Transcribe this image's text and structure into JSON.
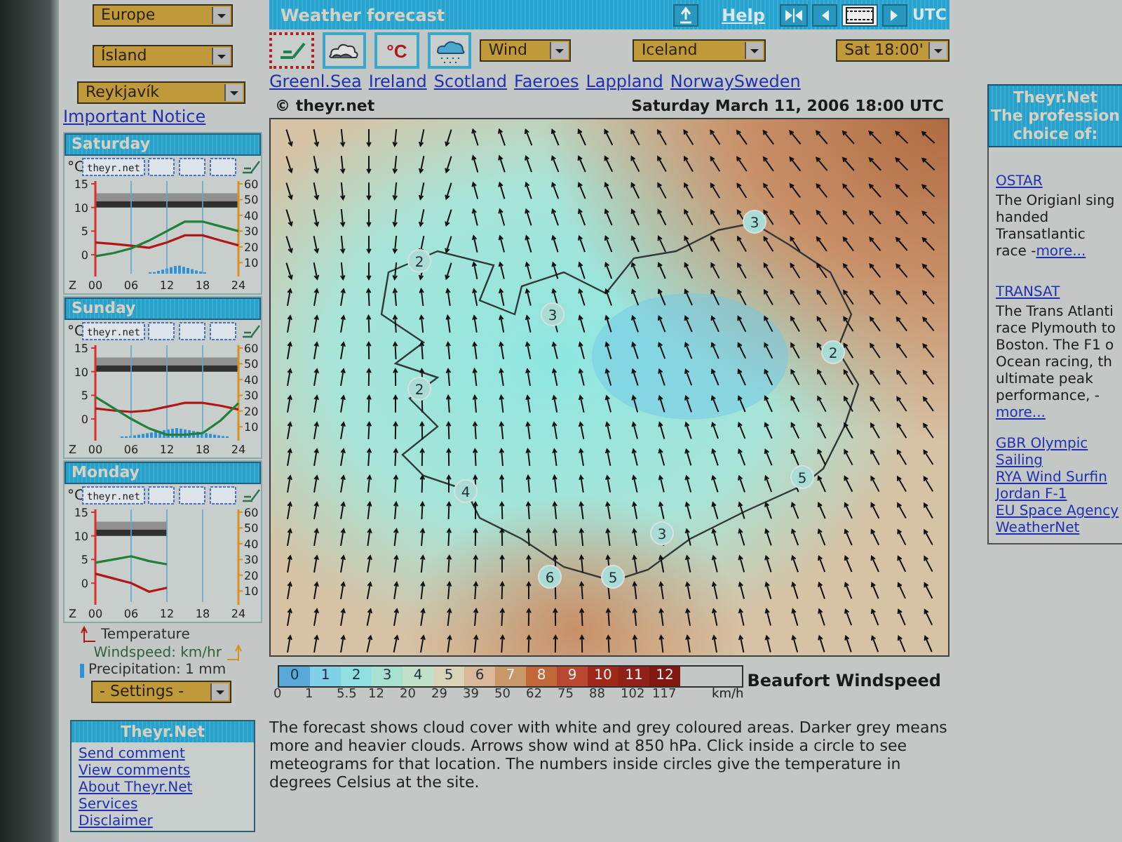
{
  "nav": {
    "continent": "Europe",
    "country": "Ísland",
    "city": "Reykjavík",
    "notice": "Important Notice"
  },
  "days": [
    {
      "title": "Saturday",
      "unit": "°C",
      "logo": "theyr.net",
      "zone": "Z",
      "chart_data": {
        "type": "line",
        "grid": true,
        "x": [
          0,
          3,
          6,
          9,
          12,
          15,
          18,
          21,
          24
        ],
        "xlim": [
          0,
          24
        ],
        "xticks": [
          {
            "value": 0,
            "label": "00"
          },
          {
            "value": 6,
            "label": "06"
          },
          {
            "value": 12,
            "label": "12"
          },
          {
            "value": 18,
            "label": "18"
          },
          {
            "value": 24,
            "label": "24"
          }
        ],
        "ylim": [
          -4,
          15
        ],
        "yticks": [
          0,
          5,
          10,
          15
        ],
        "y2lim": [
          3,
          60
        ],
        "y2ticks": [
          10,
          20,
          30,
          40,
          50,
          60
        ],
        "series": [
          {
            "color": "#b01818",
            "values": [
              2.6,
              2.3,
              1.9,
              1.5,
              2.6,
              4.1,
              4.1,
              3,
              2
            ]
          },
          {
            "axis": "y2",
            "color": "#208038",
            "values": [
              14,
              16,
              19,
              24,
              30,
              36,
              36,
              33,
              30
            ]
          }
        ]
      }
    },
    {
      "title": "Sunday",
      "unit": "°C",
      "logo": "theyr.net",
      "zone": "Z",
      "chart_data": {
        "type": "line",
        "grid": true,
        "x": [
          0,
          3,
          6,
          9,
          12,
          15,
          18,
          21,
          24
        ],
        "xlim": [
          0,
          24
        ],
        "xticks": [
          {
            "value": 0,
            "label": "00"
          },
          {
            "value": 6,
            "label": "06"
          },
          {
            "value": 12,
            "label": "12"
          },
          {
            "value": 18,
            "label": "18"
          },
          {
            "value": 24,
            "label": "24"
          }
        ],
        "ylim": [
          -4,
          15
        ],
        "yticks": [
          0,
          5,
          10,
          15
        ],
        "y2lim": [
          3,
          60
        ],
        "y2ticks": [
          10,
          20,
          30,
          40,
          50,
          60
        ],
        "series": [
          {
            "color": "#b01818",
            "values": [
              2.2,
              1.8,
              1.5,
              1.8,
              2.6,
              3.4,
              3.4,
              2.8,
              2
            ]
          },
          {
            "axis": "y2",
            "color": "#208038",
            "values": [
              29,
              22,
              15,
              9,
              5,
              5,
              6,
              14,
              25
            ]
          }
        ]
      }
    },
    {
      "title": "Monday",
      "unit": "°C",
      "logo": "theyr.net",
      "zone": "Z",
      "chart_data": {
        "type": "line",
        "grid": true,
        "x": [
          0,
          3,
          6,
          9,
          12
        ],
        "xlim": [
          0,
          24
        ],
        "xticks": [
          {
            "value": 0,
            "label": "00"
          },
          {
            "value": 6,
            "label": "06"
          },
          {
            "value": 12,
            "label": "12"
          },
          {
            "value": 18,
            "label": "18"
          },
          {
            "value": 24,
            "label": "24"
          }
        ],
        "ylim": [
          -4,
          15
        ],
        "yticks": [
          0,
          5,
          10,
          15
        ],
        "y2lim": [
          3,
          60
        ],
        "y2ticks": [
          10,
          20,
          30,
          40,
          50,
          60
        ],
        "series": [
          {
            "color": "#b01818",
            "values": [
              2,
              1,
              0,
              -1.8,
              -1
            ]
          },
          {
            "axis": "y2",
            "color": "#208038",
            "values": [
              28,
              30,
              32,
              29,
              27
            ]
          }
        ]
      }
    }
  ],
  "legend": {
    "temperature": "Temperature",
    "windspeed": "Windspeed: km/hr",
    "precipitation": "Precipitation: 1 mm"
  },
  "settings": "- Settings -",
  "links_box": {
    "title": "Theyr.Net",
    "links": [
      "Send comment",
      "View comments",
      "About Theyr.Net",
      "Services",
      "Disclaimer"
    ]
  },
  "top_bar": {
    "title": "Weather forecast",
    "help": "Help",
    "utc": "UTC"
  },
  "layers": [
    {
      "kind": "wind",
      "selected": true
    },
    {
      "kind": "cloud",
      "selected": false
    },
    {
      "kind": "text",
      "label": "°C",
      "selected": false
    },
    {
      "kind": "rain",
      "selected": false
    }
  ],
  "toolbar": {
    "parameter": "Wind",
    "region": "Iceland",
    "time": "Sat 18:00'"
  },
  "regions": [
    "Greenl.Sea",
    "Ireland",
    "Scotland",
    "Faeroes",
    "Lappland",
    "NorwaySweden"
  ],
  "map": {
    "credit": "© theyr.net",
    "timestamp": "Saturday March 11, 2006 18:00 UTC",
    "temperatures": [
      "2",
      "3",
      "3",
      "2",
      "2",
      "4",
      "5",
      "3",
      "6",
      "5"
    ]
  },
  "scale": {
    "levels": [
      {
        "label": "0",
        "color": "#58a8d8"
      },
      {
        "label": "1",
        "color": "#80d0e8"
      },
      {
        "label": "2",
        "color": "#90e0e0"
      },
      {
        "label": "3",
        "color": "#a8e0d0"
      },
      {
        "label": "4",
        "color": "#c0e0c8"
      },
      {
        "label": "5",
        "color": "#d8d4b8"
      },
      {
        "label": "6",
        "color": "#d8b898"
      },
      {
        "label": "7",
        "color": "#c89868"
      },
      {
        "label": "8",
        "color": "#c06838"
      },
      {
        "label": "9",
        "color": "#b84830"
      },
      {
        "label": "10",
        "color": "#a02818"
      },
      {
        "label": "11",
        "color": "#902018"
      },
      {
        "label": "12",
        "color": "#801810"
      }
    ],
    "speeds": [
      "0",
      "1",
      "5.5",
      "12",
      "20",
      "29",
      "39",
      "50",
      "62",
      "75",
      "88",
      "102",
      "117"
    ],
    "unit": "km/h",
    "title": "Beaufort Windspeed"
  },
  "description": "The forecast shows cloud cover with white and grey coloured areas. Darker grey means more and heavier clouds. Arrows show wind at 850 hPa. Click inside a circle to see meteograms for that location. The numbers inside circles give the temperature in degrees Celsius at the site.",
  "side": {
    "title_lines": [
      "Theyr.Net",
      "The profession",
      "choice of:"
    ],
    "entries": [
      {
        "title": "OSTAR",
        "text": "The Origianl sing handed Transatlantic race -",
        "more": "more..."
      },
      {
        "title": "TRANSAT",
        "text": "The Trans Atlanti race Plymouth to Boston. The F1 o Ocean racing, th ultimate peak performance, -",
        "more": "more..."
      }
    ],
    "links": [
      "GBR Olympic Sailing",
      "RYA Wind Surfin",
      "Jordan F-1",
      "EU Space Agency",
      "WeatherNet"
    ]
  }
}
